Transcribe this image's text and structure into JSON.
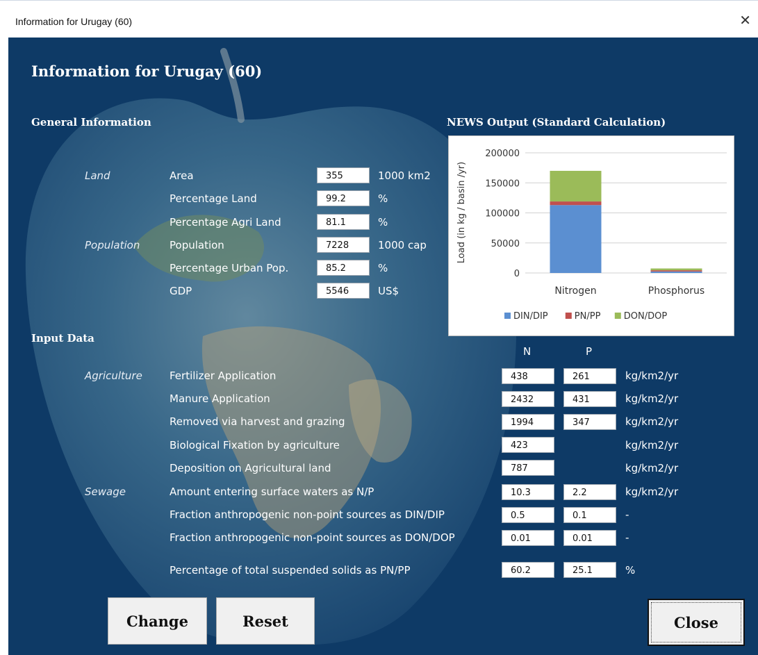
{
  "window": {
    "title": "Information for Urugay (60)",
    "close_glyph": "✕"
  },
  "heading": "Information for Urugay (60)",
  "general": {
    "title": "General Information",
    "categories": {
      "land": "Land",
      "population": "Population"
    },
    "rows": [
      {
        "label": "Area",
        "value": "355",
        "unit": "1000 km2"
      },
      {
        "label": "Percentage Land",
        "value": "99.2",
        "unit": "%"
      },
      {
        "label": "Percentage Agri Land",
        "value": "81.1",
        "unit": "%"
      },
      {
        "label": "Population",
        "value": "7228",
        "unit": "1000 cap"
      },
      {
        "label": "Percentage Urban Pop.",
        "value": "85.2",
        "unit": "%"
      },
      {
        "label": "GDP",
        "value": "5546",
        "unit": "US$"
      }
    ]
  },
  "news": {
    "title": "NEWS Output (Standard Calculation)"
  },
  "chart_data": {
    "type": "bar",
    "stacked": true,
    "categories": [
      "Nitrogen",
      "Phosphorus"
    ],
    "series": [
      {
        "name": "DIN/DIP",
        "values": [
          113000,
          2500
        ],
        "color": "#5b8fd1"
      },
      {
        "name": "PN/PP",
        "values": [
          6000,
          2000
        ],
        "color": "#c0504d"
      },
      {
        "name": "DON/DOP",
        "values": [
          51000,
          3000
        ],
        "color": "#9bbb59"
      }
    ],
    "ylabel": "Load (in kg / basin /yr)",
    "yticks": [
      "0",
      "50000",
      "100000",
      "150000",
      "200000"
    ],
    "ylim": [
      0,
      200000
    ],
    "grid": true,
    "legend": "bottom"
  },
  "input": {
    "title": "Input Data",
    "col_n": "N",
    "col_p": "P",
    "categories": {
      "agriculture": "Agriculture",
      "sewage": "Sewage"
    },
    "rows": [
      {
        "label": "Fertilizer Application",
        "n": "438",
        "p": "261",
        "unit": "kg/km2/yr"
      },
      {
        "label": "Manure Application",
        "n": "2432",
        "p": "431",
        "unit": "kg/km2/yr"
      },
      {
        "label": "Removed via harvest and grazing",
        "n": "1994",
        "p": "347",
        "unit": "kg/km2/yr"
      },
      {
        "label": "Biological Fixation by agriculture",
        "n": "423",
        "unit": "kg/km2/yr"
      },
      {
        "label": "Deposition on Agricultural land",
        "n": "787",
        "unit": "kg/km2/yr"
      },
      {
        "label": "Amount entering surface waters as N/P",
        "n": "10.3",
        "p": "2.2",
        "unit": "kg/km2/yr"
      },
      {
        "label": "Fraction anthropogenic non-point sources as DIN/DIP",
        "n": "0.5",
        "p": "0.1",
        "unit": "-"
      },
      {
        "label": "Fraction anthropogenic non-point sources as DON/DOP",
        "n": "0.01",
        "p": "0.01",
        "unit": "-"
      },
      {
        "label": "Percentage of total suspended solids as PN/PP",
        "n": "60.2",
        "p": "25.1",
        "unit": "%"
      }
    ]
  },
  "buttons": {
    "change": "Change",
    "reset": "Reset",
    "close": "Close"
  }
}
